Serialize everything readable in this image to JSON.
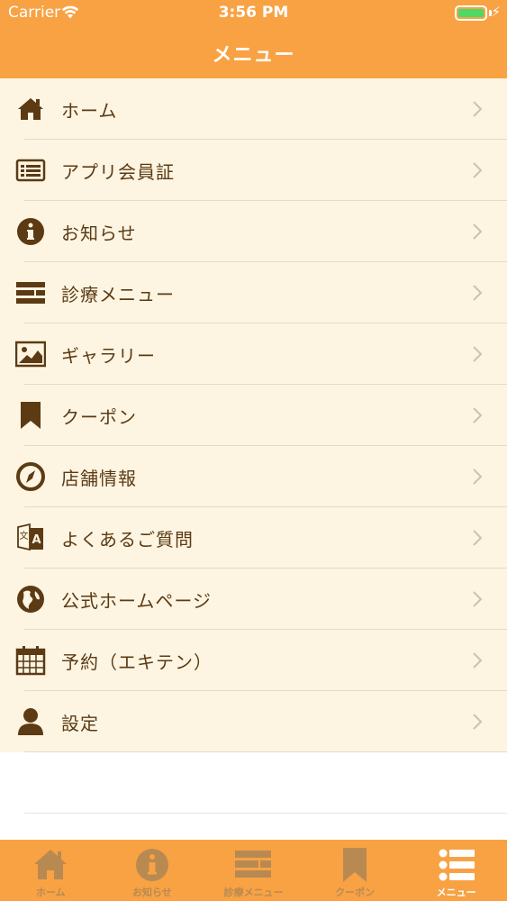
{
  "status_bar": {
    "carrier": "Carrier",
    "time": "3:56 PM"
  },
  "nav": {
    "title": "メニュー"
  },
  "menu": [
    {
      "label": "ホーム",
      "icon": "home-icon"
    },
    {
      "label": "アプリ会員証",
      "icon": "member-card-icon"
    },
    {
      "label": "お知らせ",
      "icon": "info-icon"
    },
    {
      "label": "診療メニュー",
      "icon": "list-icon"
    },
    {
      "label": "ギャラリー",
      "icon": "image-icon"
    },
    {
      "label": "クーポン",
      "icon": "bookmark-icon"
    },
    {
      "label": "店舗情報",
      "icon": "compass-icon"
    },
    {
      "label": "よくあるご質問",
      "icon": "translate-icon"
    },
    {
      "label": "公式ホームページ",
      "icon": "globe-icon"
    },
    {
      "label": "予約（エキテン）",
      "icon": "calendar-icon"
    },
    {
      "label": "設定",
      "icon": "user-icon"
    }
  ],
  "tabbar": [
    {
      "label": "ホーム",
      "icon": "home-icon",
      "active": false
    },
    {
      "label": "お知らせ",
      "icon": "info-icon",
      "active": false
    },
    {
      "label": "診療メニュー",
      "icon": "list-icon",
      "active": false
    },
    {
      "label": "クーポン",
      "icon": "bookmark-icon",
      "active": false
    },
    {
      "label": "メニュー",
      "icon": "menu-icon",
      "active": true
    }
  ],
  "colors": {
    "brand": "#f8a244",
    "menu_bg": "#fdf5e2",
    "icon_brown": "#5c3a14",
    "tab_inactive": "#b88a52"
  }
}
